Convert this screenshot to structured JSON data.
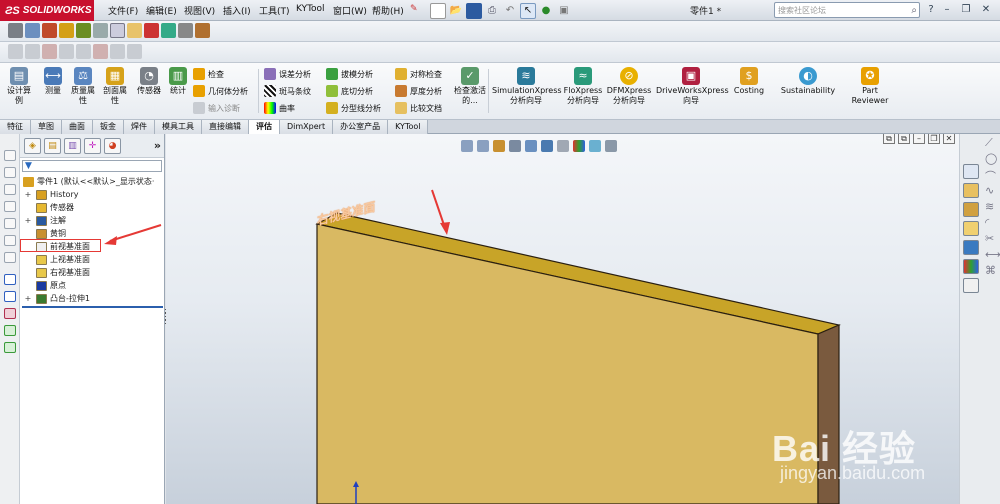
{
  "app": {
    "brand": "SOLIDWORKS",
    "doc_title": "零件1 *"
  },
  "menu": [
    "文件(F)",
    "编辑(E)",
    "视图(V)",
    "插入(I)",
    "工具(T)",
    "KYTool",
    "窗口(W)",
    "帮助(H)"
  ],
  "search": {
    "placeholder": "搜索社区论坛"
  },
  "commands": {
    "large": [
      {
        "label": "设计算例",
        "icon": "design-study-icon"
      },
      {
        "label": "测量",
        "icon": "measure-icon"
      },
      {
        "label": "质量属性",
        "icon": "mass-properties-icon"
      },
      {
        "label": "剖面属性",
        "icon": "section-properties-icon"
      },
      {
        "label": "传感器",
        "icon": "sensor-icon"
      },
      {
        "label": "统计",
        "icon": "statistics-icon"
      }
    ],
    "check_group": [
      {
        "label": "检查",
        "icon": "check-icon"
      },
      {
        "label": "几何体分析",
        "icon": "geometry-analysis-icon"
      },
      {
        "label": "输入诊断",
        "icon": "import-diagnostics-icon"
      }
    ],
    "analysis_group": [
      {
        "label": "误差分析",
        "icon": "deviation-analysis-icon"
      },
      {
        "label": "斑马条纹",
        "icon": "zebra-stripes-icon"
      },
      {
        "label": "曲率",
        "icon": "curvature-icon"
      },
      {
        "label": "拔模分析",
        "icon": "draft-analysis-icon"
      },
      {
        "label": "底切分析",
        "icon": "undercut-analysis-icon"
      },
      {
        "label": "分型线分析",
        "icon": "parting-line-analysis-icon"
      },
      {
        "label": "对称检查",
        "icon": "symmetry-check-icon"
      },
      {
        "label": "厚度分析",
        "icon": "thickness-analysis-icon"
      },
      {
        "label": "比较文档",
        "icon": "compare-documents-icon"
      }
    ],
    "check_active": {
      "label": "检查激活的...",
      "icon": "check-active-icon"
    },
    "xpress": [
      {
        "label": "SimulationXpress 分析向导",
        "icon": "simulation-xpress-icon"
      },
      {
        "label": "FloXpress 分析向导",
        "icon": "flo-xpress-icon"
      },
      {
        "label": "DFMXpress 分析向导",
        "icon": "dfm-xpress-icon"
      },
      {
        "label": "DriveWorksXpress 向导",
        "icon": "driveworks-xpress-icon"
      },
      {
        "label": "Costing",
        "icon": "costing-icon"
      },
      {
        "label": "Sustainability",
        "icon": "sustainability-icon"
      },
      {
        "label": "Part Reviewer",
        "icon": "part-reviewer-icon"
      }
    ]
  },
  "tabs": [
    {
      "label": "特征",
      "active": false
    },
    {
      "label": "草图",
      "active": false
    },
    {
      "label": "曲面",
      "active": false
    },
    {
      "label": "钣金",
      "active": false
    },
    {
      "label": "焊件",
      "active": false
    },
    {
      "label": "模具工具",
      "active": false
    },
    {
      "label": "直接编辑",
      "active": false
    },
    {
      "label": "评估",
      "active": true
    },
    {
      "label": "DimXpert",
      "active": false
    },
    {
      "label": "办公室产品",
      "active": false
    },
    {
      "label": "KYTool",
      "active": false
    }
  ],
  "tree": {
    "root": "零件1  (默认<<默认>_显示状态·",
    "items": [
      {
        "label": "History",
        "expander": "+",
        "icon": "history-icon"
      },
      {
        "label": "传感器",
        "expander": "",
        "icon": "sensor-folder-icon"
      },
      {
        "label": "注解",
        "expander": "+",
        "icon": "annotations-icon"
      },
      {
        "label": "黄铜",
        "expander": "",
        "icon": "material-icon"
      },
      {
        "label": "前视基准面",
        "expander": "",
        "icon": "plane-icon"
      },
      {
        "label": "上视基准面",
        "expander": "",
        "icon": "plane-icon"
      },
      {
        "label": "右视基准面",
        "expander": "",
        "icon": "plane-icon"
      },
      {
        "label": "原点",
        "expander": "",
        "icon": "origin-icon"
      },
      {
        "label": "凸台-拉伸1",
        "expander": "+",
        "icon": "extrude-icon"
      }
    ]
  },
  "viewport": {
    "plane_label": "右视基准面",
    "part_top_color": "#c8a428",
    "part_front_color": "#d9b962",
    "part_side_color": "#7a5a3e"
  },
  "watermark": {
    "main": "Bai 经验",
    "sub": "jingyan.baidu.com"
  }
}
